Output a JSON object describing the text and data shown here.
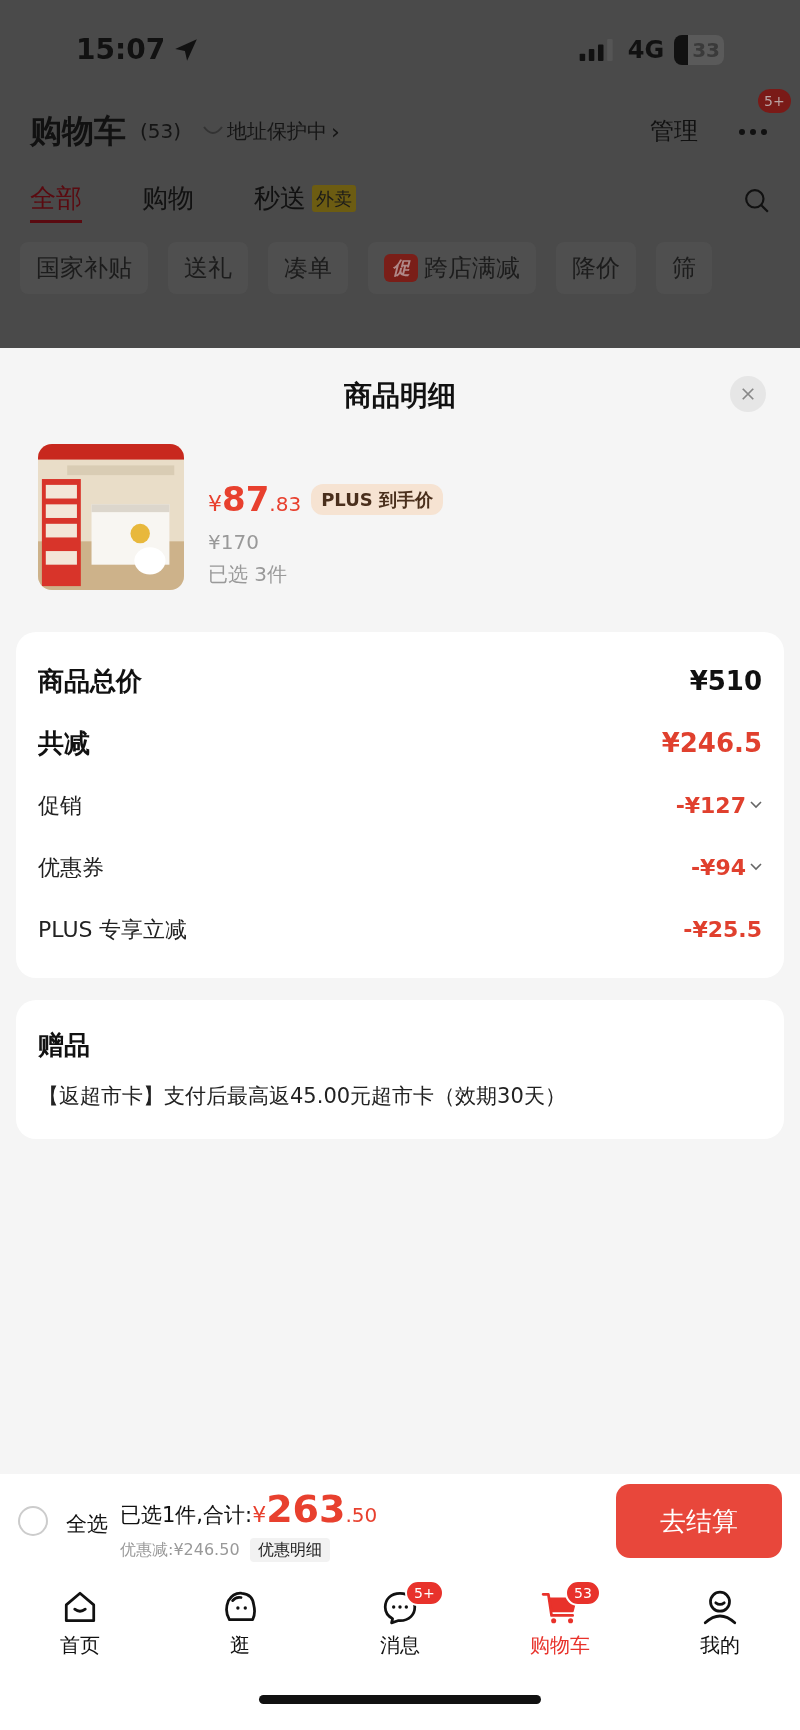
{
  "status_bar": {
    "time": "15:07",
    "network": "4G",
    "battery": "33"
  },
  "header": {
    "title": "购物车",
    "count": "(53)",
    "address": "地址保护中",
    "address_arrow": "›",
    "manage": "管理",
    "more_badge": "5+"
  },
  "tabs": [
    {
      "label": "全部",
      "selected": true
    },
    {
      "label": "购物",
      "selected": false
    },
    {
      "label": "秒送",
      "selected": false,
      "tag": "外卖"
    }
  ],
  "filters": [
    {
      "label": "国家补贴"
    },
    {
      "label": "送礼"
    },
    {
      "label": "凑单"
    },
    {
      "label": "跨店满减",
      "tag": "促"
    },
    {
      "label": "降价"
    },
    {
      "label": "筛"
    }
  ],
  "sheet": {
    "title": "商品明细",
    "product": {
      "currency": "¥",
      "price_integer": "87",
      "price_decimal": ".83",
      "badge": "PLUS 到手价",
      "original_price": "¥170",
      "quantity": "已选 3件"
    },
    "summary": [
      {
        "kind": "total",
        "label": "商品总价",
        "value": "¥510",
        "expandable": false
      },
      {
        "kind": "reduction",
        "label": "共减",
        "value": "¥246.5",
        "expandable": false
      },
      {
        "kind": "item",
        "label": "促销",
        "value": "-¥127",
        "expandable": true
      },
      {
        "kind": "item",
        "label": "优惠券",
        "value": "-¥94",
        "expandable": true
      },
      {
        "kind": "item",
        "label": "PLUS 专享立减",
        "value": "-¥25.5",
        "expandable": false
      }
    ],
    "gift": {
      "title": "赠品",
      "text": "【返超市卡】支付后最高返45.00元超市卡（效期30天）"
    }
  },
  "footer": {
    "select_all": {
      "label": "全选",
      "checked": false
    },
    "summary": "已选1件,合计:",
    "currency": "¥",
    "total_integer": "263",
    "total_decimal": ".50",
    "discount": "优惠减:¥246.50",
    "detail_button": "优惠明细",
    "checkout": "去结算"
  },
  "nav": [
    {
      "label": "首页",
      "selected": false
    },
    {
      "label": "逛",
      "selected": false
    },
    {
      "label": "消息",
      "selected": false,
      "badge": "5+"
    },
    {
      "label": "购物车",
      "selected": true,
      "badge": "53"
    },
    {
      "label": "我的",
      "selected": false
    }
  ]
}
